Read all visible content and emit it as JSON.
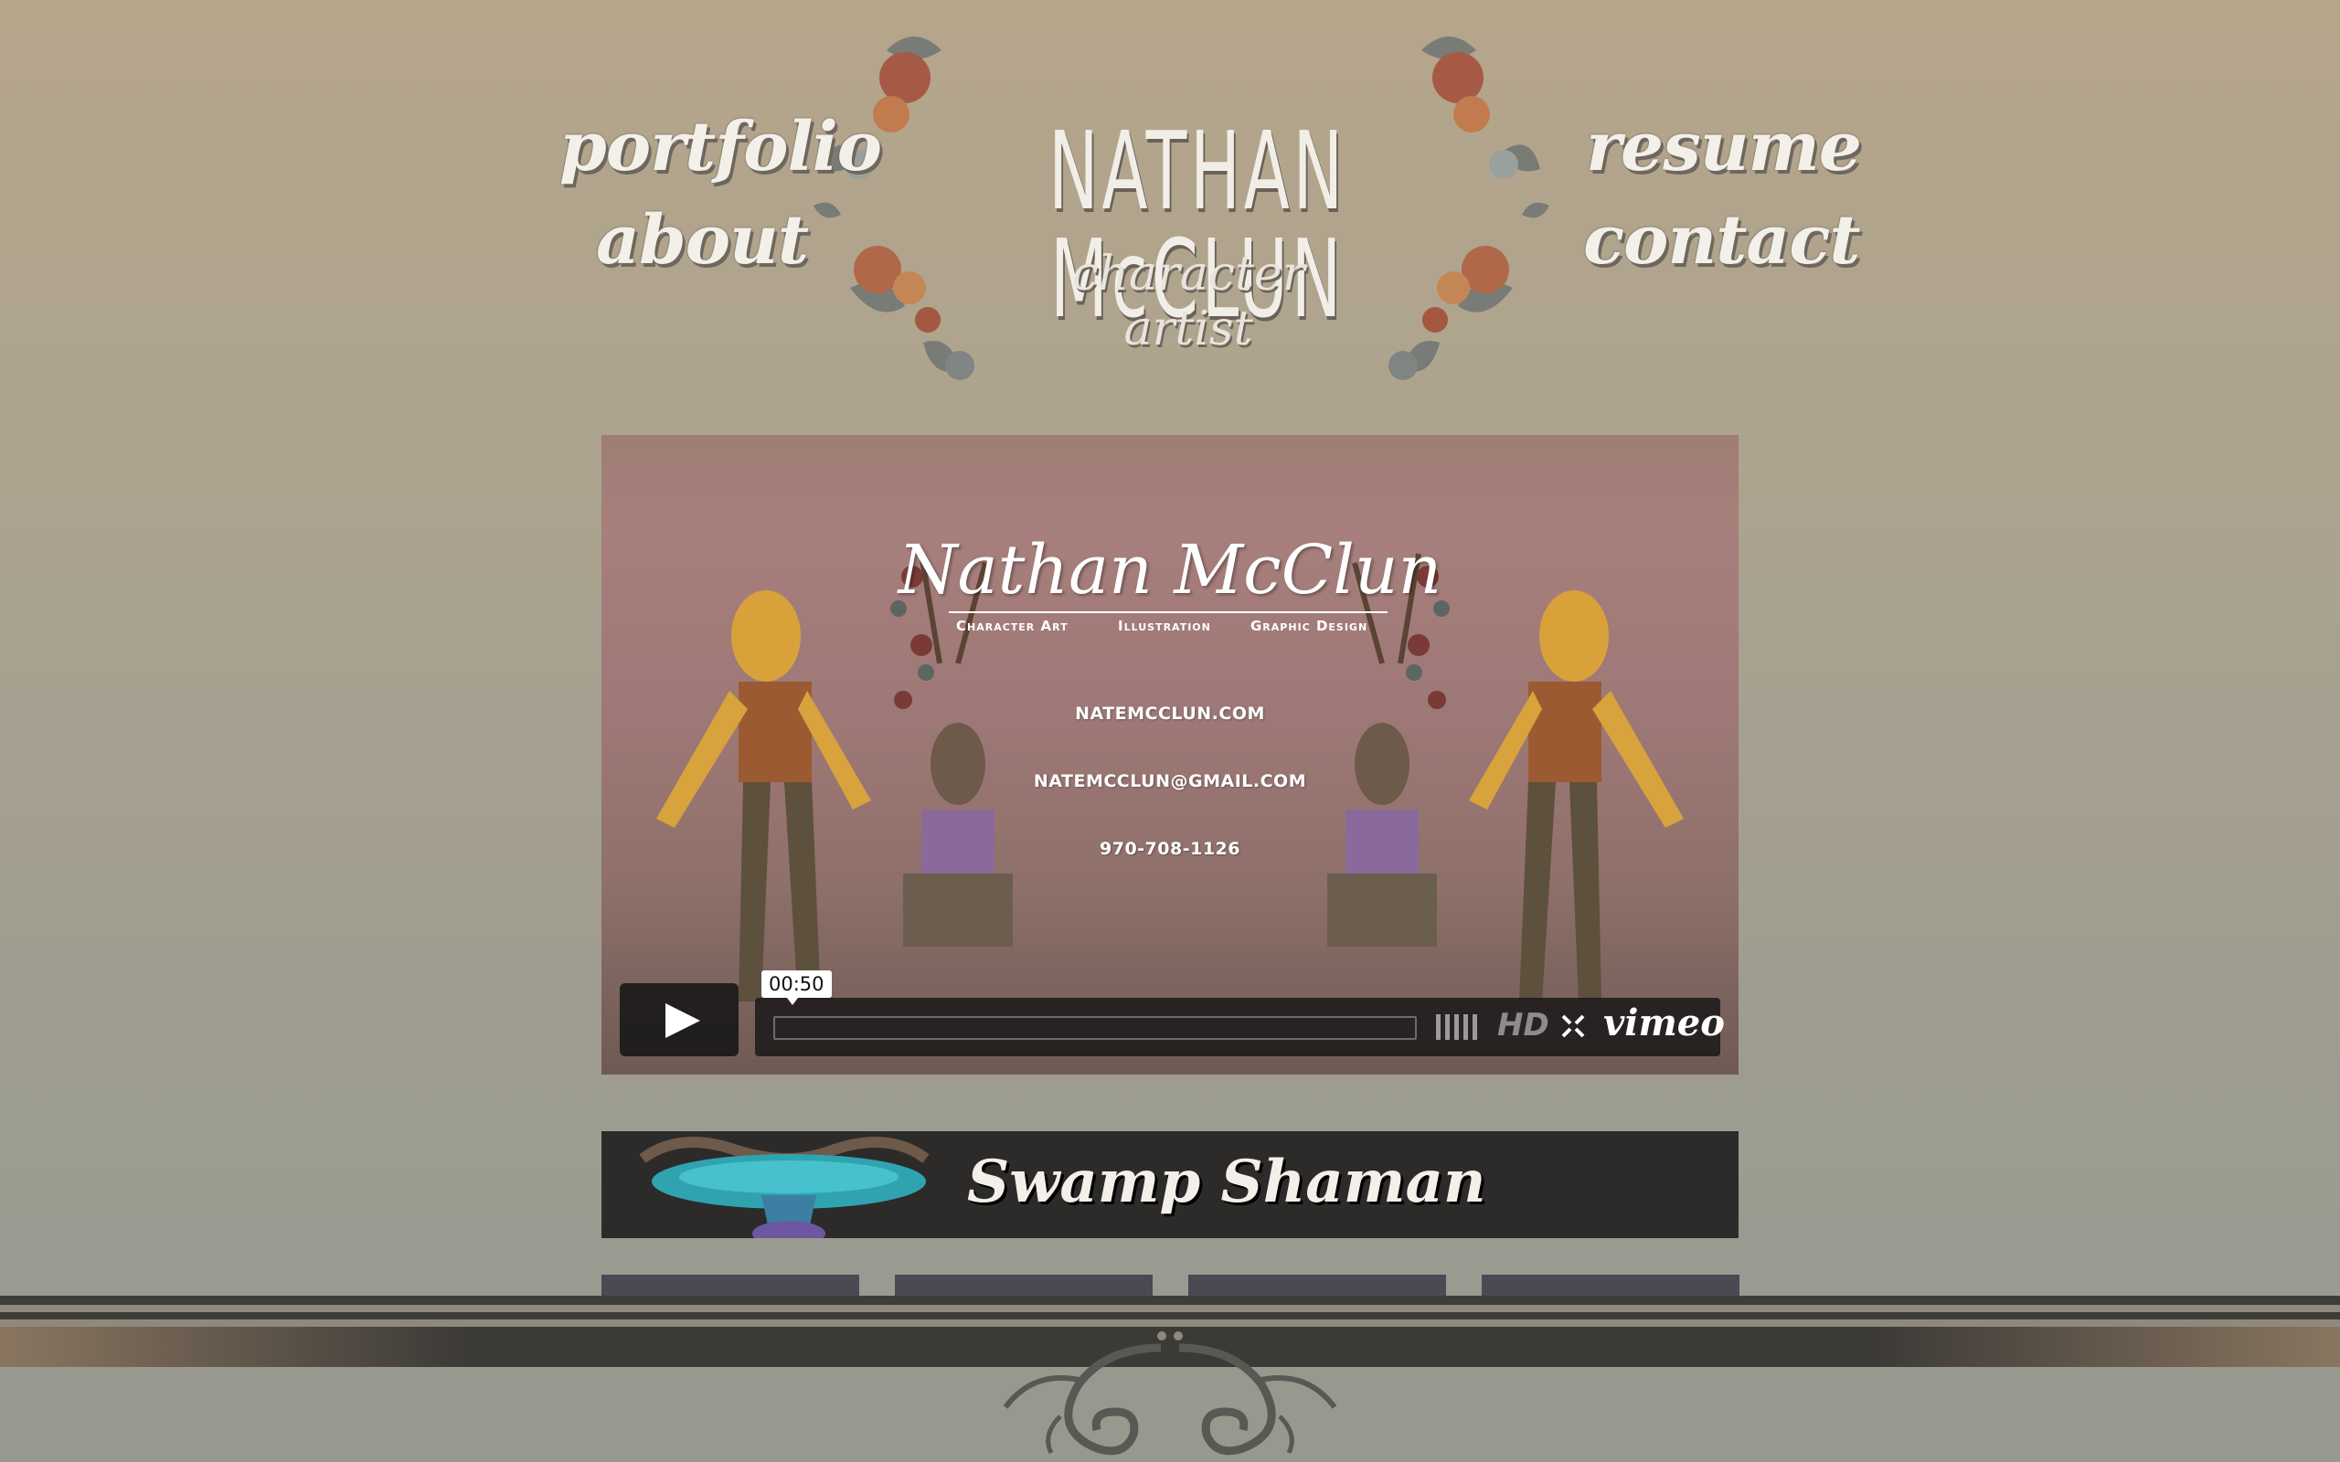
{
  "nav": {
    "portfolio": "portfolio",
    "about": "about",
    "resume": "resume",
    "contact": "contact"
  },
  "logo": {
    "title": "NATHAN McCLUN",
    "subtitle": "character artist"
  },
  "video": {
    "title": "Nathan McClun",
    "tags": [
      "Character Art",
      "Illustration",
      "Graphic Design"
    ],
    "website": "NATEMCCLUN.COM",
    "email": "NATEMCCLUN@GMAIL.COM",
    "phone": "970-708-1126",
    "time": "00:50",
    "hd_label": "HD",
    "brand": "vimeo",
    "progress": 0
  },
  "project": {
    "title": "Swamp Shaman"
  },
  "colors": {
    "nav_text": "#f3f0ea",
    "banner_bg": "#2c2b2a",
    "footer_band": "#3c3a37"
  }
}
